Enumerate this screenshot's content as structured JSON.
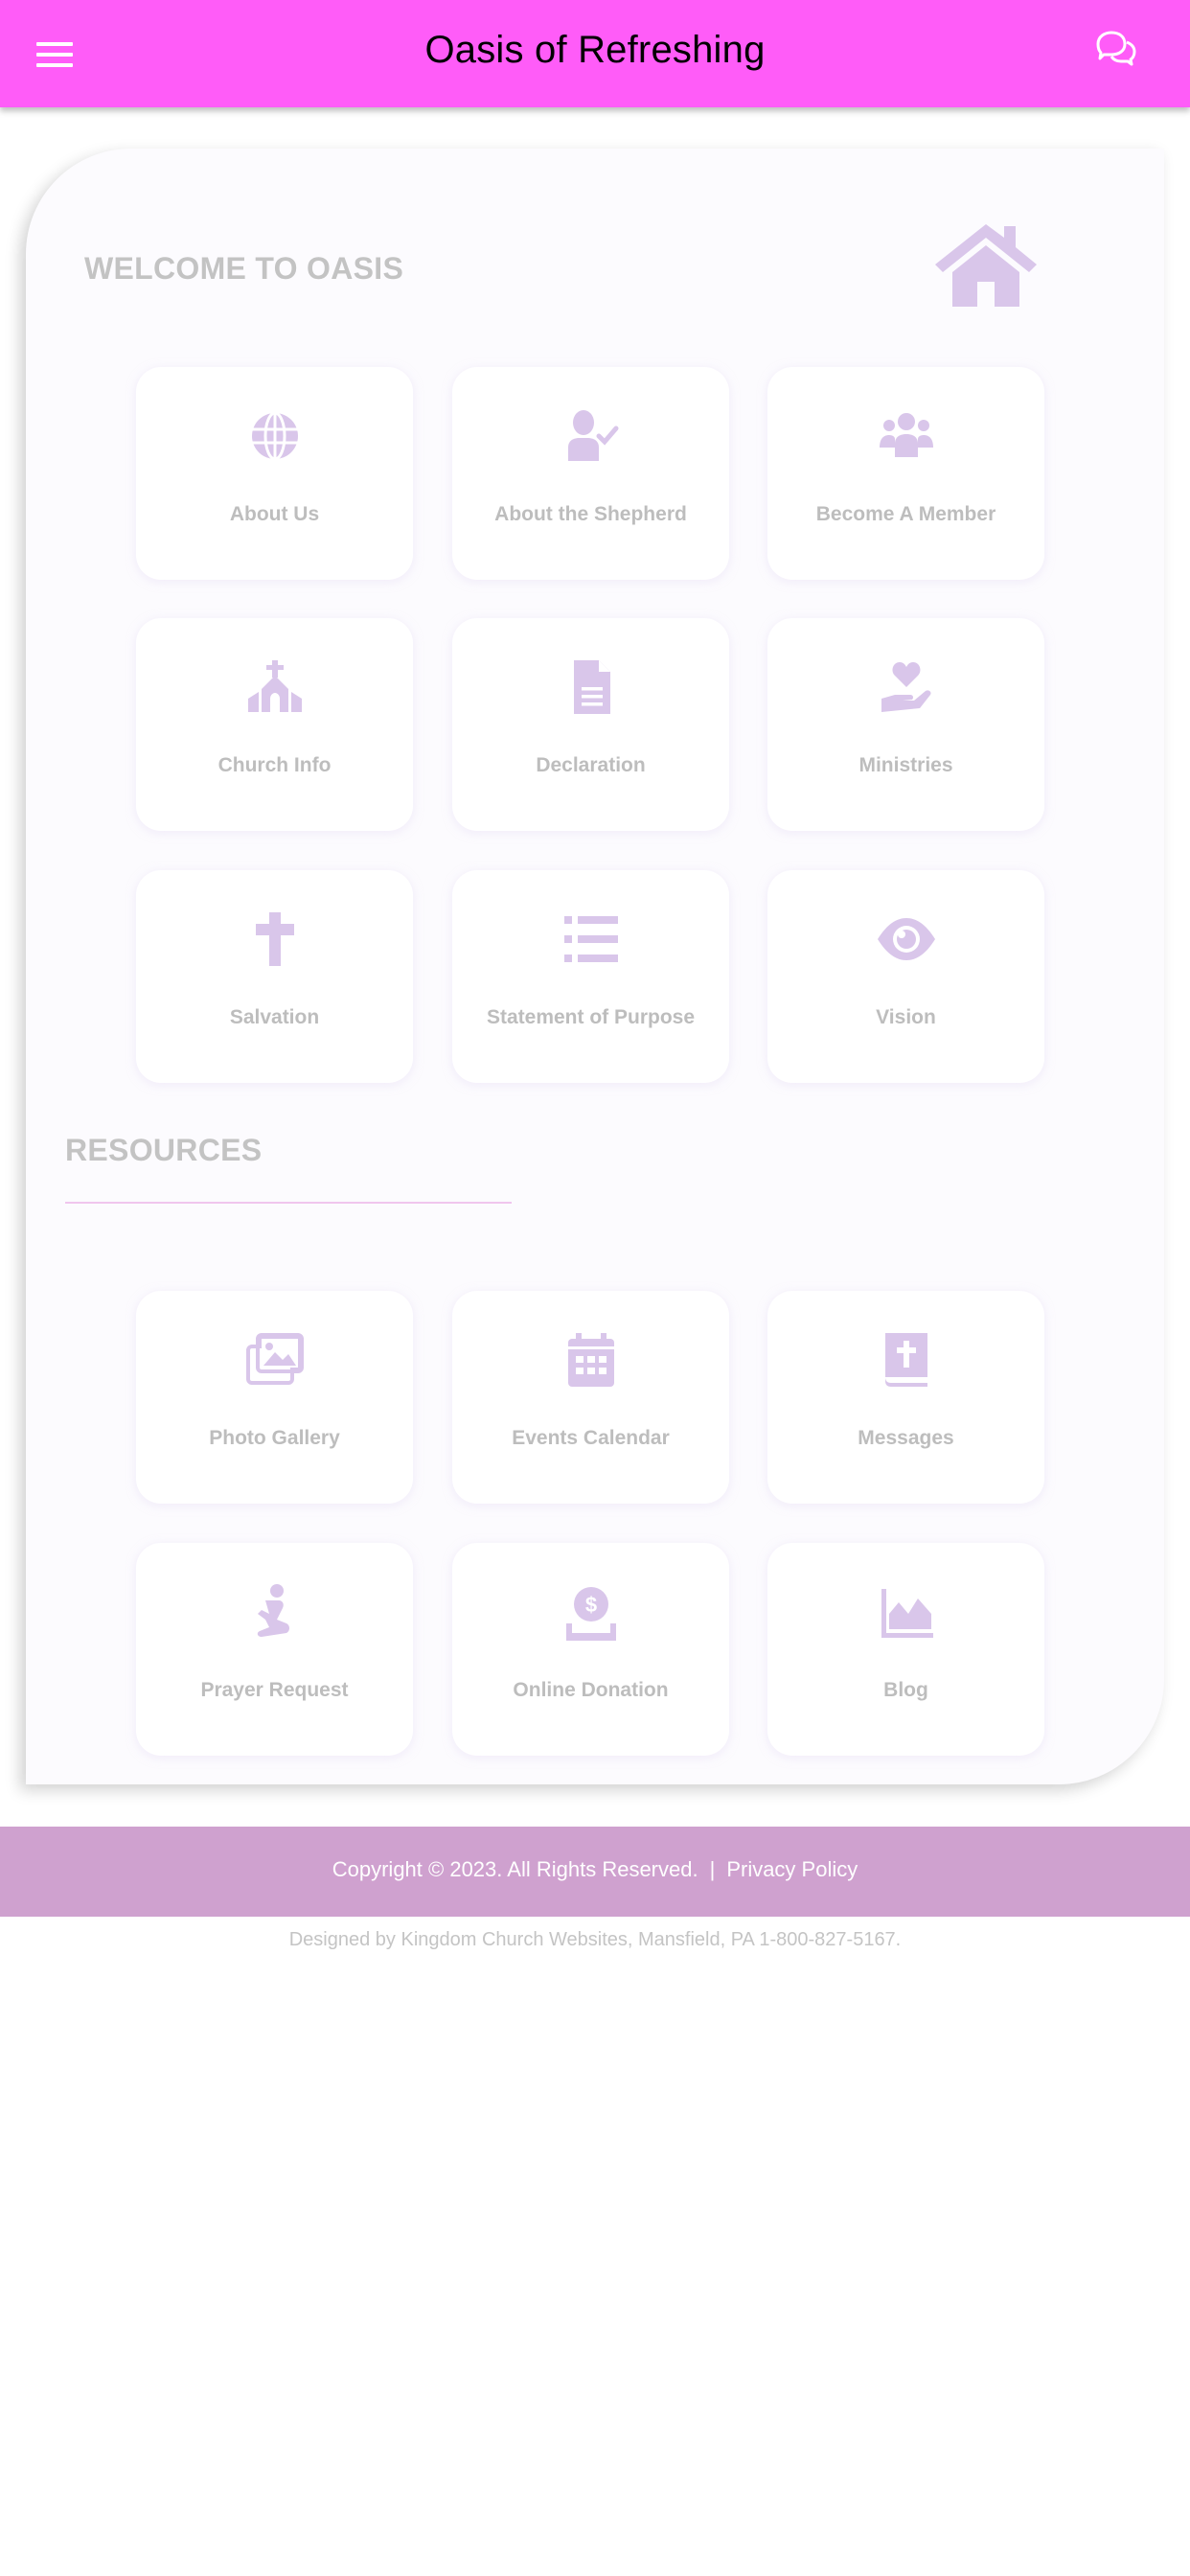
{
  "header": {
    "title": "Oasis of Refreshing",
    "menu_icon": "hamburger-menu-icon",
    "chat_icon": "chat-bubbles-icon",
    "bg_color": "#ff5cf8"
  },
  "welcome": {
    "heading": "WELCOME TO OASIS",
    "icon": "home-icon",
    "tiles": [
      {
        "label": "About Us",
        "icon": "globe-icon"
      },
      {
        "label": "About the Shepherd",
        "icon": "user-check-icon"
      },
      {
        "label": "Become A Member",
        "icon": "users-icon"
      },
      {
        "label": "Church Info",
        "icon": "church-icon"
      },
      {
        "label": "Declaration",
        "icon": "document-icon"
      },
      {
        "label": "Ministries",
        "icon": "hand-holding-heart-icon"
      },
      {
        "label": "Salvation",
        "icon": "cross-icon"
      },
      {
        "label": "Statement of Purpose",
        "icon": "list-icon"
      },
      {
        "label": "Vision",
        "icon": "eye-icon"
      }
    ]
  },
  "resources": {
    "heading": "RESOURCES",
    "tiles": [
      {
        "label": "Photo Gallery",
        "icon": "images-icon"
      },
      {
        "label": "Events Calendar",
        "icon": "calendar-icon"
      },
      {
        "label": "Messages",
        "icon": "bible-icon"
      },
      {
        "label": "Prayer Request",
        "icon": "praying-person-icon"
      },
      {
        "label": "Online Donation",
        "icon": "donate-icon"
      },
      {
        "label": "Blog",
        "icon": "area-chart-icon"
      }
    ]
  },
  "footer": {
    "copyright": "Copyright © 2023. All Rights Reserved.",
    "separator": "|",
    "privacy_link": "Privacy Policy",
    "designed_by": "Designed by Kingdom Church Websites, Mansfield, PA 1-800-827-5167.",
    "bg_color": "#cfa1cf"
  },
  "colors": {
    "icon": "#d9c6ea",
    "label": "#bdbdbd",
    "heading": "#c3c3c3"
  }
}
